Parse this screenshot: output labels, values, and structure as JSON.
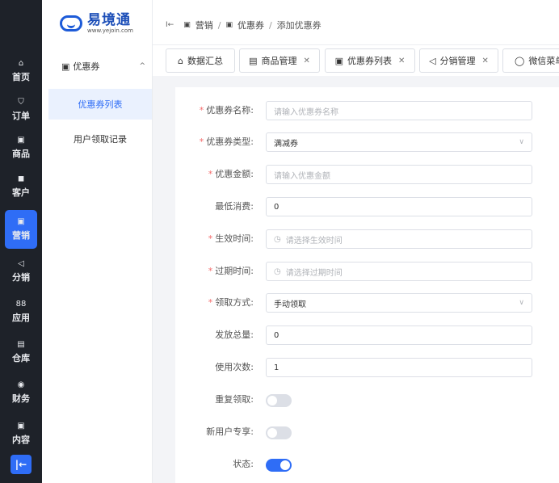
{
  "rail": {
    "items": [
      {
        "icon": "⌂",
        "label": "首页"
      },
      {
        "icon": "⛉",
        "label": "订单"
      },
      {
        "icon": "▣",
        "label": "商品"
      },
      {
        "icon": "◼",
        "label": "客户"
      },
      {
        "icon": "▣",
        "label": "营销"
      },
      {
        "icon": "◁",
        "label": "分销"
      },
      {
        "icon": "88",
        "label": "应用"
      },
      {
        "icon": "▤",
        "label": "仓库"
      },
      {
        "icon": "◉",
        "label": "财务"
      },
      {
        "icon": "▣",
        "label": "内容"
      }
    ],
    "collapse_icon": "|←"
  },
  "logo": {
    "title": "易境通",
    "subtitle": "www.yejoin.com"
  },
  "sidebar": {
    "group_label": "优惠券",
    "group_icon": "▣",
    "chevron": "^",
    "items": [
      {
        "label": "优惠券列表"
      },
      {
        "label": "用户领取记录"
      }
    ]
  },
  "breadcrumb": {
    "collapse_icon": "I←",
    "items": [
      {
        "icon": "▣",
        "label": "营销"
      },
      {
        "icon": "▣",
        "label": "优惠券"
      },
      {
        "icon": "",
        "label": "添加优惠券"
      }
    ],
    "separator": "/"
  },
  "tabs": [
    {
      "icon": "⌂",
      "label": "数据汇总",
      "close": ""
    },
    {
      "icon": "▤",
      "label": "商品管理",
      "close": "✕"
    },
    {
      "icon": "▣",
      "label": "优惠券列表",
      "close": "✕"
    },
    {
      "icon": "◁",
      "label": "分销管理",
      "close": "✕"
    },
    {
      "icon": "◯",
      "label": "微信菜单",
      "close": ""
    }
  ],
  "form": {
    "required_mark": "*",
    "fields": [
      {
        "label": "优惠券名称:",
        "required": true,
        "value": "",
        "placeholder": "请输入优惠券名称"
      },
      {
        "label": "优惠券类型:",
        "required": true,
        "value": "满减券",
        "suffix": "∨"
      },
      {
        "label": "优惠金额:",
        "required": true,
        "value": "",
        "placeholder": "请输入优惠金额"
      },
      {
        "label": "最低消费:",
        "required": false,
        "value": "0"
      },
      {
        "label": "生效时间:",
        "required": true,
        "value": "",
        "placeholder": "请选择生效时间",
        "icon": "◷"
      },
      {
        "label": "过期时间:",
        "required": true,
        "value": "",
        "placeholder": "请选择过期时间",
        "icon": "◷"
      },
      {
        "label": "领取方式:",
        "required": true,
        "value": "手动领取",
        "suffix": "∨"
      },
      {
        "label": "发放总量:",
        "required": false,
        "value": "0"
      },
      {
        "label": "使用次数:",
        "required": false,
        "value": "1"
      }
    ],
    "switches": [
      {
        "label": "重复领取:",
        "on": false
      },
      {
        "label": "新用户专享:",
        "on": false
      },
      {
        "label": "状态:",
        "on": true
      }
    ]
  }
}
